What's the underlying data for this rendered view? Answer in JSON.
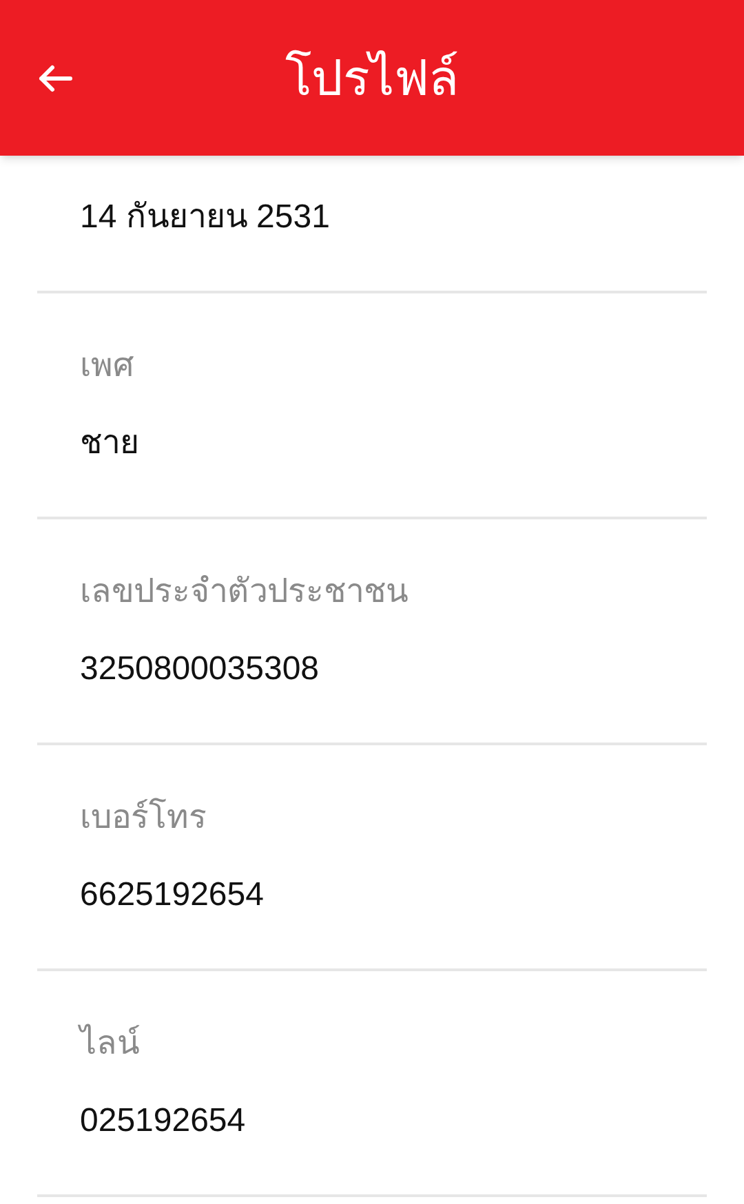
{
  "header": {
    "title": "โปรไฟล์"
  },
  "fields": [
    {
      "value": "14 กันยายน 2531"
    },
    {
      "label": "เพศ",
      "value": "ชาย"
    },
    {
      "label": "เลขประจำตัวประชาชน",
      "value": "3250800035308"
    },
    {
      "label": "เบอร์โทร",
      "value": "6625192654"
    },
    {
      "label": "ไลน์",
      "value": "025192654"
    }
  ]
}
